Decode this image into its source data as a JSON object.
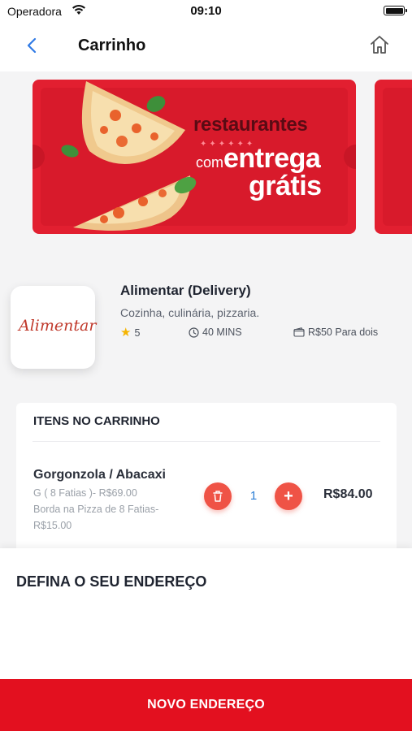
{
  "status_bar": {
    "carrier": "Operadora",
    "time": "09:10"
  },
  "nav": {
    "title": "Carrinho",
    "back_icon": "chevron-left-icon",
    "home_icon": "home-icon"
  },
  "banner": {
    "headline": "restaurantes",
    "connector": "com",
    "line1": "entrega",
    "line2": "grátis",
    "background_color": "#e21f30"
  },
  "restaurant": {
    "logo_text": "Alimentar",
    "name": "Alimentar (Delivery)",
    "cuisine": "Cozinha, culinária, pizzaria.",
    "rating": "5",
    "delivery_time": "40 MINS",
    "price_for_two": "R$50 Para dois"
  },
  "cart": {
    "title": "ITENS NO CARRINHO",
    "items": [
      {
        "name": "Gorgonzola / Abacaxi",
        "option_line_1": "G ( 8 Fatias )- R$69.00",
        "option_line_2": "Borda na Pizza de 8 Fatias-",
        "option_line_3": "R$15.00",
        "quantity": "1",
        "price": "R$84.00"
      }
    ]
  },
  "address": {
    "title": "DEFINA O SEU ENDEREÇO",
    "new_address_label": "NOVO ENDEREÇO"
  },
  "colors": {
    "accent": "#e3101f",
    "qty_button": "#ef5346",
    "quantity_text": "#2d7fd6",
    "rating_star": "#f5b400"
  }
}
